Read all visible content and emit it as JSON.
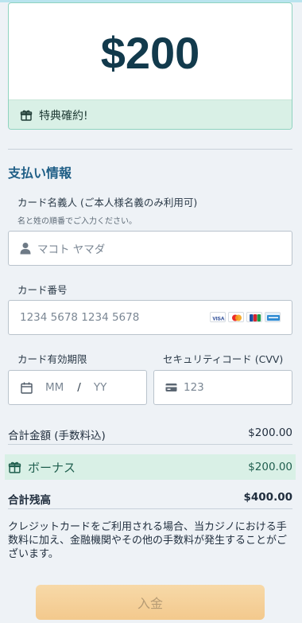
{
  "amount": {
    "value": "$200"
  },
  "bonus_banner": {
    "label": "特典確約!"
  },
  "payment": {
    "section_title": "支払い情報",
    "card_holder": {
      "label": "カード名義人 (ご本人様名義のみ利用可)",
      "hint": "名と姓の順番でご入力ください。",
      "placeholder": "マコト ヤマダ"
    },
    "card_number": {
      "label": "カード番号",
      "placeholder": "1234 5678 1234 5678",
      "brands": [
        "VISA",
        "Mastercard",
        "JCB",
        "Amex"
      ]
    },
    "expiry": {
      "label": "カード有効期限",
      "month_placeholder": "MM",
      "separator": "/",
      "year_placeholder": "YY"
    },
    "cvv": {
      "label": "セキュリティコード (CVV)",
      "placeholder": "123"
    }
  },
  "summary": {
    "total_label": "合計金額 (手数料込)",
    "total_value": "$200.00",
    "bonus_label": "ボーナス",
    "bonus_value": "$200.00",
    "balance_label": "合計残高",
    "balance_value": "$400.00"
  },
  "note": "クレジットカードをご利用される場合、当カジノにおける手数料に加え、金融機関やその他の手数料が発生することがございます。",
  "deposit_button": {
    "label": "入金"
  },
  "colors": {
    "accent": "#1e5e86",
    "amount_text": "#123a4c",
    "bonus_bg": "#d9f0e6",
    "button_bg": "#f3c98d"
  }
}
